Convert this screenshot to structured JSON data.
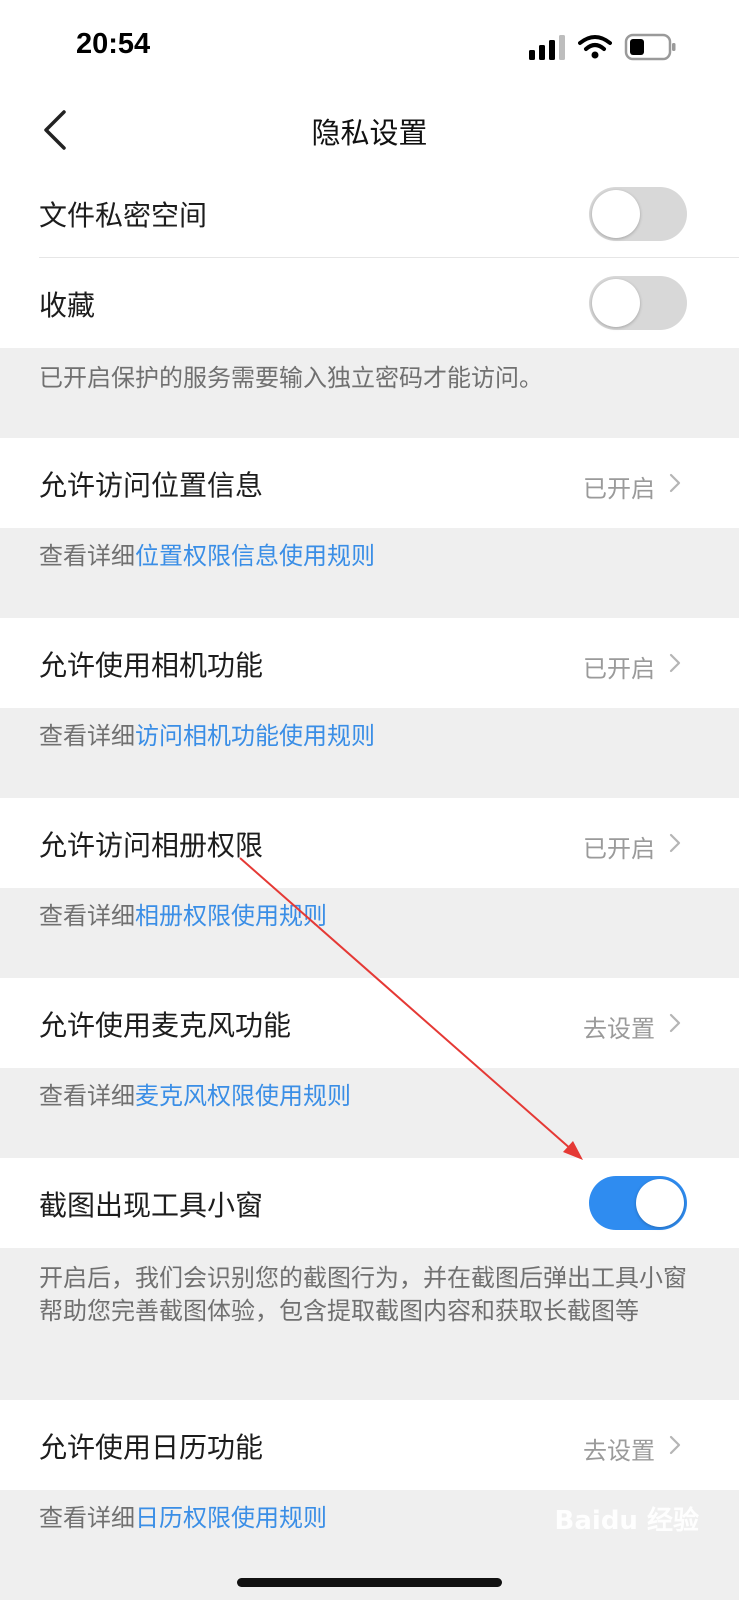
{
  "status_bar": {
    "time": "20:54"
  },
  "nav": {
    "title": "隐私设置"
  },
  "toggles": [
    {
      "label": "文件私密空间",
      "on": false
    },
    {
      "label": "收藏",
      "on": false
    }
  ],
  "protection_note": "已开启保护的服务需要输入独立密码才能访问。",
  "permissions": [
    {
      "label": "允许访问位置信息",
      "status": "已开启",
      "desc_prefix": "查看详细",
      "desc_link": "位置权限信息使用规则"
    },
    {
      "label": "允许使用相机功能",
      "status": "已开启",
      "desc_prefix": "查看详细",
      "desc_link": "访问相机功能使用规则"
    },
    {
      "label": "允许访问相册权限",
      "status": "已开启",
      "desc_prefix": "查看详细",
      "desc_link": "相册权限使用规则"
    },
    {
      "label": "允许使用麦克风功能",
      "status": "去设置",
      "desc_prefix": "查看详细",
      "desc_link": "麦克风权限使用规则"
    }
  ],
  "screenshot_toolbar": {
    "label": "截图出现工具小窗",
    "on": true,
    "desc": "开启后，我们会识别您的截图行为，并在截图后弹出工具小窗帮助您完善截图体验，包含提取截图内容和获取长截图等"
  },
  "calendar": {
    "label": "允许使用日历功能",
    "status": "去设置",
    "desc_prefix": "查看详细",
    "desc_link": "日历权限使用规则"
  },
  "watermark": "Baidu 经验",
  "colors": {
    "accent": "#2f8cf0",
    "link": "#3a8ee6",
    "annotation_arrow": "#e53935"
  },
  "icons": [
    "cellular-signal-icon",
    "wifi-icon",
    "battery-icon",
    "back-chevron-icon",
    "chevron-right-icon"
  ]
}
